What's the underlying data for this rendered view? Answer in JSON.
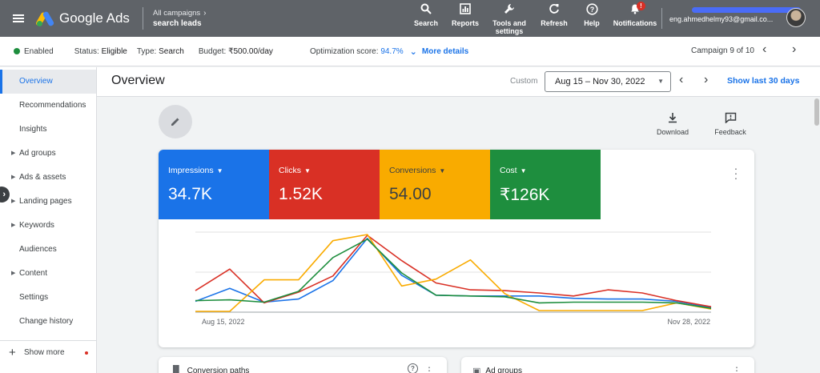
{
  "topbar": {
    "app_name": "Google Ads",
    "breadcrumb_parent": "All campaigns",
    "breadcrumb_current": "search leads",
    "tools": [
      {
        "label": "Search",
        "icon": "search-icon"
      },
      {
        "label": "Reports",
        "icon": "reports-icon"
      },
      {
        "label": "Tools and settings",
        "icon": "wrench-icon"
      },
      {
        "label": "Refresh",
        "icon": "refresh-icon"
      },
      {
        "label": "Help",
        "icon": "help-icon"
      },
      {
        "label": "Notifications",
        "icon": "bell-icon",
        "badge": "!"
      }
    ],
    "account_email": "eng.ahmedhelmy93@gmail.co..."
  },
  "status": {
    "enabled": "Enabled",
    "status_label": "Status:",
    "status_value": "Eligible",
    "type_label": "Type:",
    "type_value": "Search",
    "budget_label": "Budget:",
    "budget_value": "₹500.00/day",
    "opt_label": "Optimization score:",
    "opt_value": "94.7%",
    "more_details": "More details",
    "campaign_count": "Campaign 9 of 10"
  },
  "sidebar": {
    "items": [
      {
        "label": "Overview",
        "active": true,
        "expandable": false
      },
      {
        "label": "Recommendations",
        "expandable": false
      },
      {
        "label": "Insights",
        "expandable": false
      },
      {
        "label": "Ad groups",
        "expandable": true
      },
      {
        "label": "Ads & assets",
        "expandable": true
      },
      {
        "label": "Landing pages",
        "expandable": true
      },
      {
        "label": "Keywords",
        "expandable": true
      },
      {
        "label": "Audiences",
        "expandable": false
      },
      {
        "label": "Content",
        "expandable": true
      },
      {
        "label": "Settings",
        "expandable": false
      },
      {
        "label": "Change history",
        "expandable": false
      }
    ],
    "show_more": "Show more"
  },
  "header": {
    "title": "Overview",
    "date_label": "Custom",
    "date_range": "Aug 15 – Nov 30, 2022",
    "show_last": "Show last 30 days"
  },
  "actions": {
    "download": "Download",
    "feedback": "Feedback"
  },
  "metrics": [
    {
      "label": "Impressions",
      "value": "34.7K",
      "color": "#1a73e8"
    },
    {
      "label": "Clicks",
      "value": "1.52K",
      "color": "#d93025"
    },
    {
      "label": "Conversions",
      "value": "54.00",
      "color": "#f9ab00"
    },
    {
      "label": "Cost",
      "value": "₹126K",
      "color": "#1e8e3e"
    }
  ],
  "chart_data": {
    "type": "line",
    "x_start_label": "Aug 15, 2022",
    "x_end_label": "Nov 28, 2022",
    "points": 16,
    "ylim": [
      0,
      100
    ],
    "grid": true,
    "series": [
      {
        "name": "Impressions",
        "color": "#1a73e8",
        "values": [
          13,
          30,
          12,
          16,
          40,
          95,
          47,
          21,
          20,
          20,
          20,
          17,
          16,
          16,
          13,
          5
        ]
      },
      {
        "name": "Clicks",
        "color": "#d93025",
        "values": [
          27,
          55,
          11,
          25,
          46,
          99,
          66,
          37,
          28,
          27,
          24,
          20,
          28,
          24,
          14,
          6
        ]
      },
      {
        "name": "Conversions",
        "color": "#f9ab00",
        "values": [
          0,
          0,
          41,
          41,
          92,
          100,
          33,
          42,
          67,
          23,
          1,
          1,
          1,
          1,
          11,
          3
        ]
      },
      {
        "name": "Cost",
        "color": "#1e8e3e",
        "values": [
          14,
          15,
          12,
          26,
          70,
          94,
          50,
          21,
          20,
          19,
          11,
          12,
          12,
          12,
          11,
          4
        ]
      }
    ]
  },
  "cards": {
    "conversion_paths": "Conversion paths",
    "ad_groups": "Ad groups"
  }
}
